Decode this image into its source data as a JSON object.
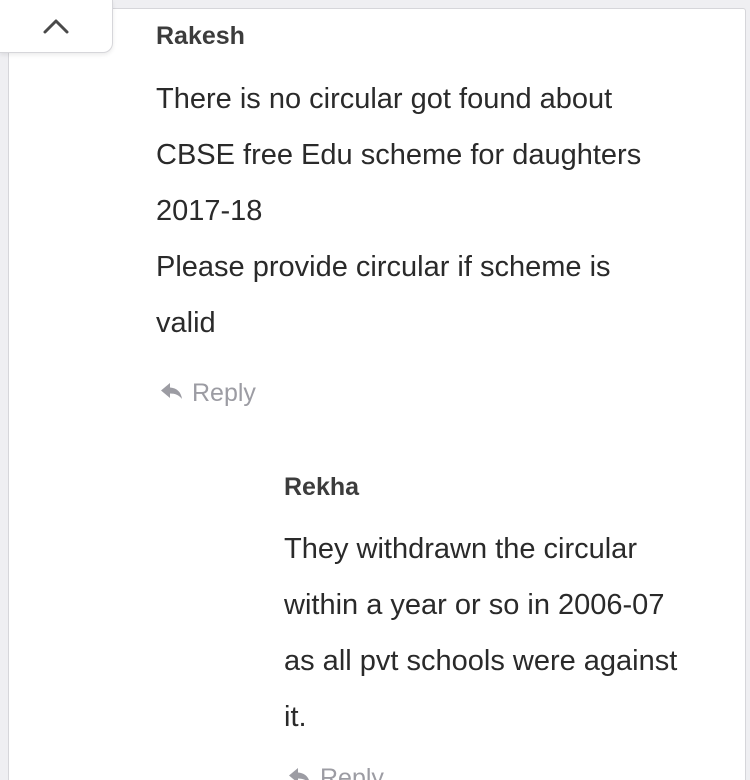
{
  "comments": [
    {
      "author": "Rakesh",
      "lines": [
        "There is no circular got found about",
        "CBSE free Edu scheme for daughters",
        "2017-18",
        "Please provide circular if scheme is",
        "valid"
      ],
      "reply_label": "Reply"
    },
    {
      "author": "Rekha",
      "lines": [
        "They withdrawn the circular",
        "within a year or so in 2006-07",
        "as all pvt schools were against",
        "it."
      ],
      "reply_label": "Reply"
    }
  ],
  "icons": {
    "scroll_top": "chevron-up-icon",
    "reply": "reply-arrow-icon"
  },
  "colors": {
    "background": "#efeff2",
    "card": "#ffffff",
    "text": "#2a2a2a",
    "muted": "#9c9ca3"
  }
}
